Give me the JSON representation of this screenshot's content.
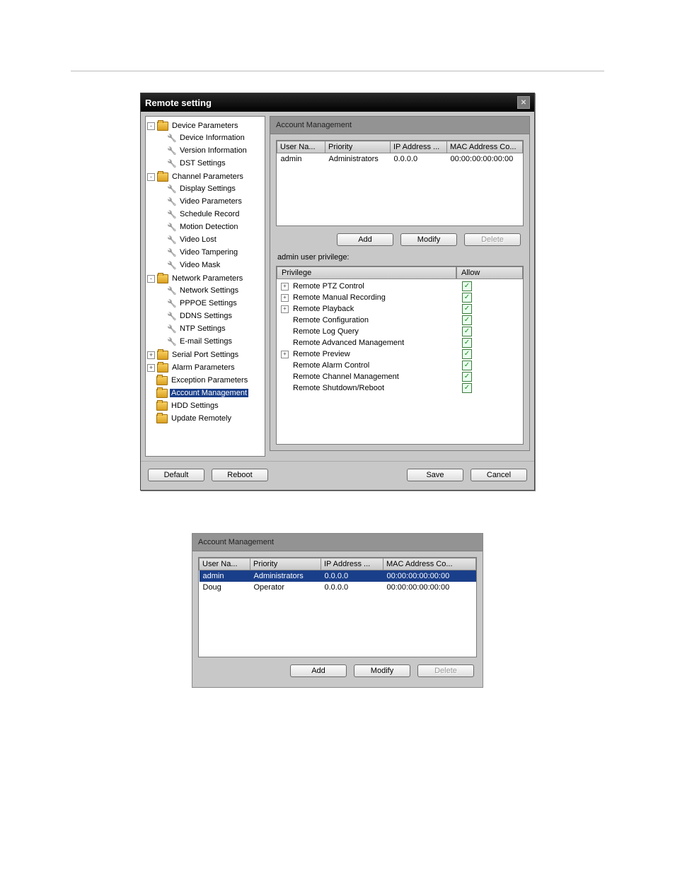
{
  "window": {
    "title": "Remote setting"
  },
  "tree": [
    {
      "label": "Device Parameters",
      "type": "folder",
      "exp": "-",
      "children": [
        {
          "label": "Device Information",
          "type": "leaf"
        },
        {
          "label": "Version Information",
          "type": "leaf"
        },
        {
          "label": "DST Settings",
          "type": "leaf"
        }
      ]
    },
    {
      "label": "Channel Parameters",
      "type": "folder",
      "exp": "-",
      "children": [
        {
          "label": "Display Settings",
          "type": "leaf"
        },
        {
          "label": "Video Parameters",
          "type": "leaf"
        },
        {
          "label": "Schedule Record",
          "type": "leaf"
        },
        {
          "label": "Motion Detection",
          "type": "leaf"
        },
        {
          "label": "Video Lost",
          "type": "leaf"
        },
        {
          "label": "Video Tampering",
          "type": "leaf"
        },
        {
          "label": "Video Mask",
          "type": "leaf"
        }
      ]
    },
    {
      "label": "Network Parameters",
      "type": "folder",
      "exp": "-",
      "children": [
        {
          "label": "Network Settings",
          "type": "leaf"
        },
        {
          "label": "PPPOE Settings",
          "type": "leaf"
        },
        {
          "label": "DDNS Settings",
          "type": "leaf"
        },
        {
          "label": "NTP Settings",
          "type": "leaf"
        },
        {
          "label": "E-mail Settings",
          "type": "leaf"
        }
      ]
    },
    {
      "label": "Serial Port Settings",
      "type": "folder",
      "exp": "+",
      "children": []
    },
    {
      "label": "Alarm Parameters",
      "type": "folder",
      "exp": "+",
      "children": []
    },
    {
      "label": "Exception Parameters",
      "type": "folder",
      "exp": "",
      "children": []
    },
    {
      "label": "Account Management",
      "type": "folder",
      "exp": "",
      "selected": true,
      "children": []
    },
    {
      "label": "HDD Settings",
      "type": "folder",
      "exp": "",
      "children": []
    },
    {
      "label": "Update Remotely",
      "type": "folder",
      "exp": "",
      "children": []
    }
  ],
  "panel": {
    "title": "Account Management",
    "columns": [
      "User Na...",
      "Priority",
      "IP Address ...",
      "MAC Address Co..."
    ],
    "rows": [
      {
        "user": "admin",
        "priority": "Administrators",
        "ip": "0.0.0.0",
        "mac": "00:00:00:00:00:00",
        "selected": false
      }
    ],
    "buttons": {
      "add": "Add",
      "modify": "Modify",
      "delete": "Delete"
    },
    "priv_label": "admin user privilege:",
    "priv_columns": {
      "c1": "Privilege",
      "c2": "Allow"
    },
    "privileges": [
      {
        "label": "Remote PTZ Control",
        "expandable": true,
        "checked": true
      },
      {
        "label": "Remote Manual Recording",
        "expandable": true,
        "checked": true
      },
      {
        "label": "Remote Playback",
        "expandable": true,
        "checked": true
      },
      {
        "label": "Remote Configuration",
        "expandable": false,
        "checked": true
      },
      {
        "label": "Remote Log Query",
        "expandable": false,
        "checked": true
      },
      {
        "label": "Remote Advanced Management",
        "expandable": false,
        "checked": true
      },
      {
        "label": "Remote Preview",
        "expandable": true,
        "checked": true
      },
      {
        "label": "Remote Alarm Control",
        "expandable": false,
        "checked": true
      },
      {
        "label": "Remote Channel Management",
        "expandable": false,
        "checked": true
      },
      {
        "label": "Remote Shutdown/Reboot",
        "expandable": false,
        "checked": true
      }
    ]
  },
  "footer": {
    "default": "Default",
    "reboot": "Reboot",
    "save": "Save",
    "cancel": "Cancel"
  },
  "panel2": {
    "title": "Account Management",
    "columns": [
      "User Na...",
      "Priority",
      "IP Address ...",
      "MAC Address Co..."
    ],
    "rows": [
      {
        "user": "admin",
        "priority": "Administrators",
        "ip": "0.0.0.0",
        "mac": "00:00:00:00:00:00",
        "selected": true
      },
      {
        "user": "Doug",
        "priority": "Operator",
        "ip": "0.0.0.0",
        "mac": "00:00:00:00:00:00",
        "selected": false
      }
    ],
    "buttons": {
      "add": "Add",
      "modify": "Modify",
      "delete": "Delete"
    }
  }
}
